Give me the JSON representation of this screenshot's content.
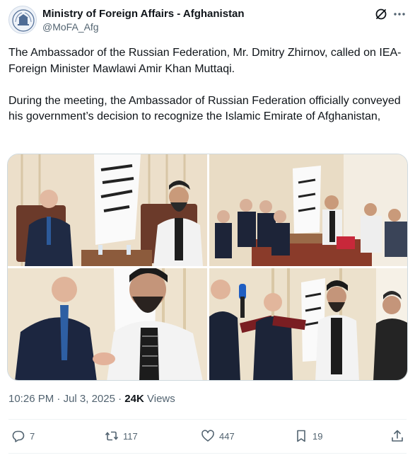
{
  "author": {
    "name": "Ministry of Foreign Affairs - Afghanistan",
    "handle": "@MoFA_Afg"
  },
  "tweet": {
    "paragraphs": [
      "The Ambassador of the Russian Federation, Mr. Dmitry Zhirnov, called on IEA-Foreign Minister Mawlawi Amir Khan Muttaqi.",
      "During the meeting, the Ambassador of Russian Federation officially conveyed his government’s decision to recognize the Islamic Emirate of Afghanistan,"
    ]
  },
  "meta": {
    "time": "10:26 PM",
    "separator": "·",
    "date": "Jul 3, 2025",
    "views_count": "24K",
    "views_label": "Views"
  },
  "actions": {
    "replies": "7",
    "reposts": "117",
    "likes": "447",
    "bookmarks": "19"
  },
  "colors": {
    "text": "#0f1419",
    "secondary": "#536471",
    "border": "#cfd9de"
  },
  "icons": [
    "grok-icon",
    "more-icon",
    "reply-icon",
    "repost-icon",
    "like-icon",
    "bookmark-icon",
    "share-icon"
  ]
}
